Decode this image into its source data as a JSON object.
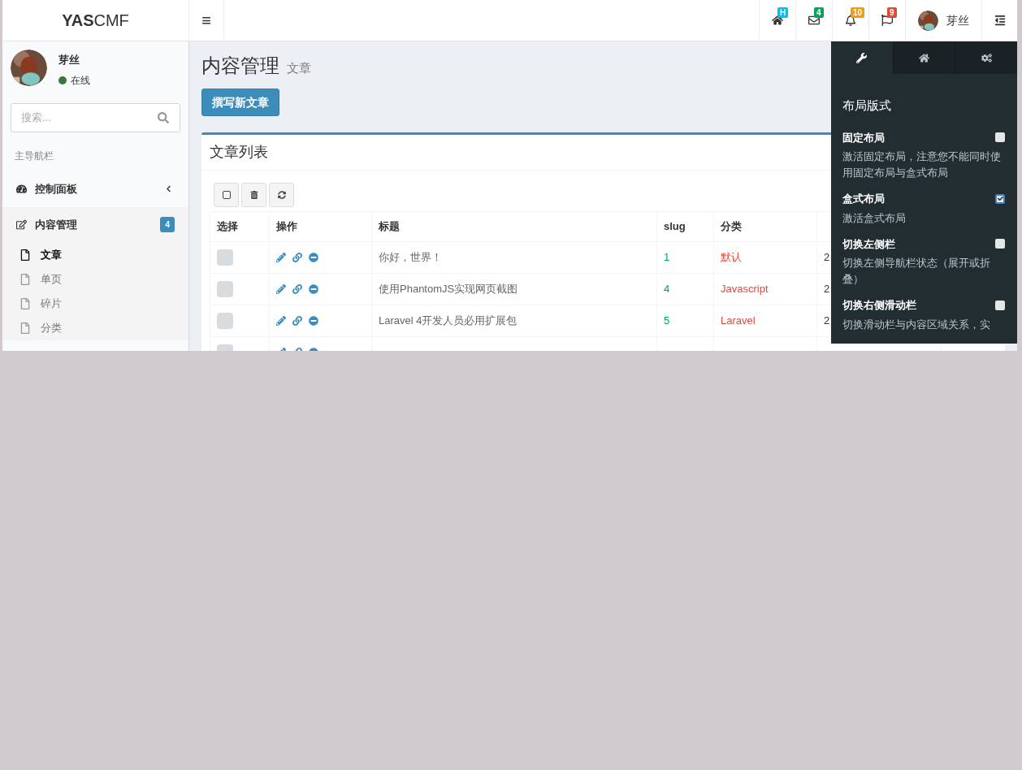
{
  "header": {
    "logo_bold": "YAS",
    "logo_rest": "CMF",
    "menu_icon": "≡",
    "notifications": [
      {
        "kind": "home",
        "badge": "H",
        "color": "#00c0ef"
      },
      {
        "kind": "mail",
        "badge": "4",
        "color": "#00a65a"
      },
      {
        "kind": "bell",
        "badge": "10",
        "color": "#f39c12"
      },
      {
        "kind": "flag",
        "badge": "9",
        "color": "#dd4b39"
      }
    ],
    "user_name": "芽丝"
  },
  "sidebar": {
    "user_name": "芽丝",
    "status": "在线",
    "search_placeholder": "搜索...",
    "section": "主导航栏",
    "items": [
      {
        "kind": "dashboard",
        "label": "控制面板",
        "expanded": false
      },
      {
        "kind": "edit",
        "label": "内容管理",
        "expanded": true,
        "badge": "4",
        "children": [
          {
            "label": "文章",
            "selected": true
          },
          {
            "label": "单页",
            "selected": false
          },
          {
            "label": "碎片",
            "selected": false
          },
          {
            "label": "分类",
            "selected": false
          }
        ]
      }
    ]
  },
  "content": {
    "title": "内容管理",
    "subtitle": "文章",
    "new_button": "撰写新文章",
    "box_title": "文章列表",
    "table": {
      "columns": [
        "选择",
        "操作",
        "标题",
        "slug",
        "分类"
      ],
      "rows": [
        {
          "checked": false,
          "title": "你好，世界！",
          "slug": "1",
          "category": "默认",
          "column_6": "2"
        },
        {
          "checked": false,
          "title": "使用PhantomJS实现网页截图",
          "slug": "4",
          "category": "Javascript",
          "column_6": "2"
        },
        {
          "checked": false,
          "title": "Laravel 4开发人员必用扩展包",
          "slug": "5",
          "category": "Laravel",
          "column_6": "2"
        },
        {
          "checked": false
        }
      ]
    }
  },
  "control_sidebar": {
    "tabs": [
      {
        "kind": "wrench",
        "selected": true
      },
      {
        "kind": "home",
        "selected": false
      },
      {
        "kind": "gears",
        "selected": false
      }
    ],
    "heading": "布局版式",
    "options": [
      {
        "label": "固定布局",
        "checked": false,
        "description": "激活固定布局，注意您不能同时使用固定布局与盒式布局"
      },
      {
        "label": "盒式布局",
        "checked": true,
        "description": "激活盒式布局"
      },
      {
        "label": "切换左侧栏",
        "checked": false,
        "description": "切换左侧导航栏状态（展开或折叠）"
      },
      {
        "label": "切换右侧滑动栏",
        "checked": false,
        "description": "切换滑动栏与内容区域关系，实"
      }
    ]
  }
}
